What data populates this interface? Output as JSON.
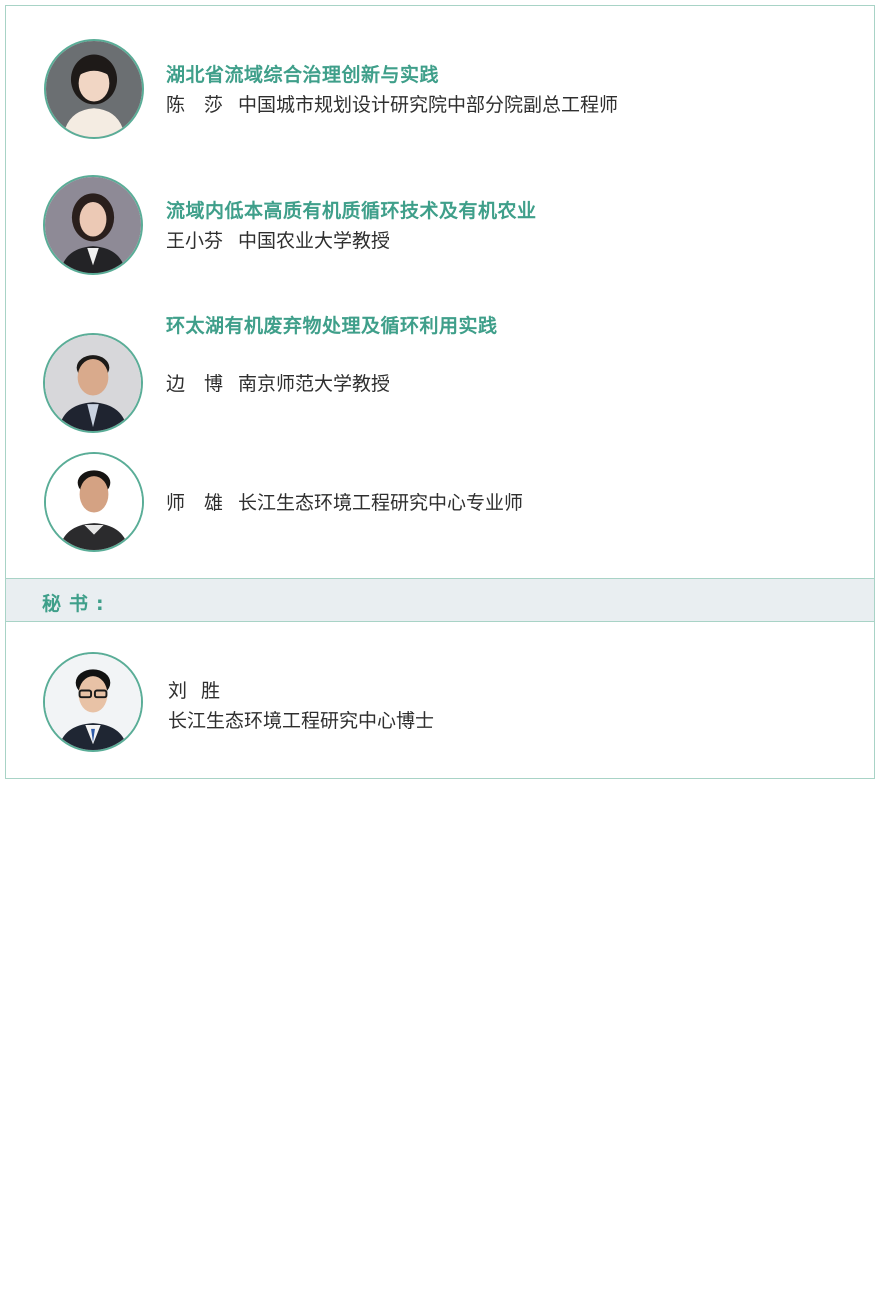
{
  "speakers": [
    {
      "topic": "湖北省流域综合治理创新与实践",
      "name": "陈　莎",
      "affiliation": "中国城市规划设计研究院中部分院副总工程师"
    },
    {
      "topic": "流域内低本高质有机质循环技术及有机农业",
      "name": "王小芬",
      "affiliation": "中国农业大学教授"
    },
    {
      "topic": "环太湖有机废弃物处理及循环利用实践",
      "name": "边　博",
      "affiliation": "南京师范大学教授"
    },
    {
      "topic": "",
      "name": "师　雄",
      "affiliation": "长江生态环境工程研究中心专业师"
    }
  ],
  "secretary": {
    "label": "秘书:",
    "name": "刘胜",
    "affiliation": "长江生态环境工程研究中心博士"
  },
  "colors": {
    "accent": "#3f9f8a",
    "border": "#a8d3c6",
    "bar": "#e9eef1"
  }
}
